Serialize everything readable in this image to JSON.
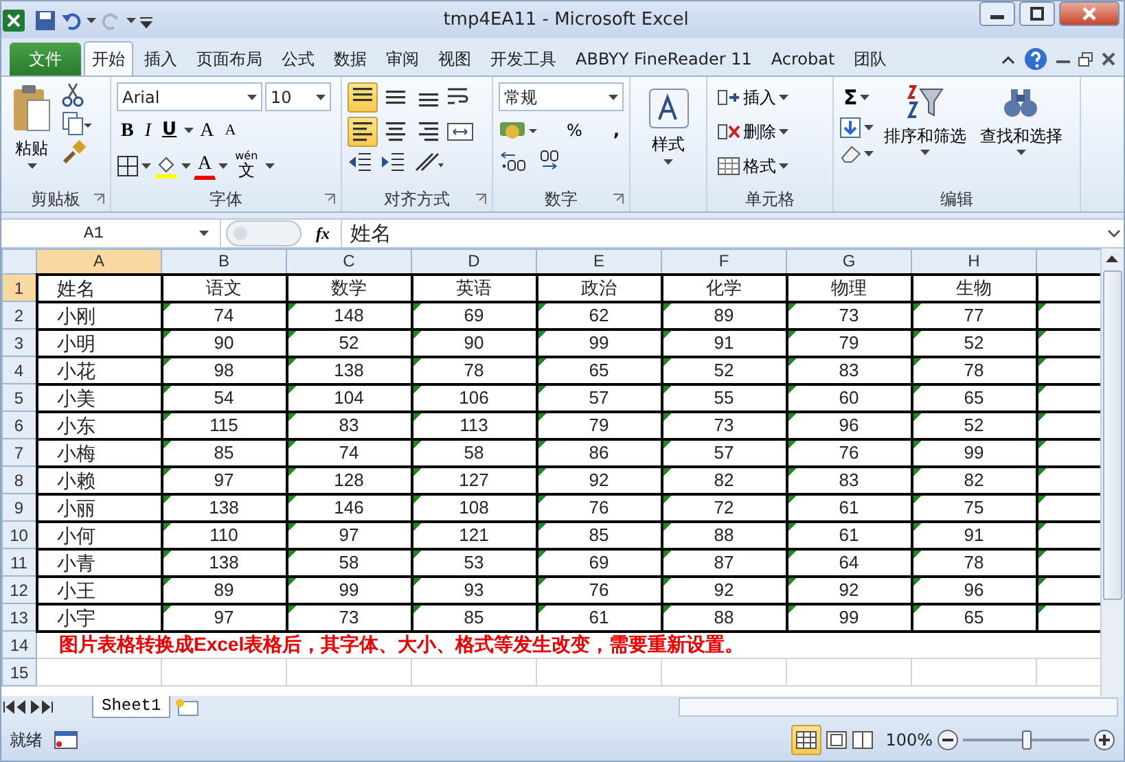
{
  "window": {
    "title": "tmp4EA11  -  Microsoft Excel"
  },
  "ribbon_tabs": [
    {
      "label": "文件",
      "kind": "file"
    },
    {
      "label": "开始",
      "kind": "tab",
      "selected": true
    },
    {
      "label": "插入",
      "kind": "tab",
      "selected": false
    },
    {
      "label": "页面布局",
      "kind": "tab",
      "selected": false
    },
    {
      "label": "公式",
      "kind": "tab",
      "selected": false
    },
    {
      "label": "数据",
      "kind": "tab",
      "selected": false
    },
    {
      "label": "审阅",
      "kind": "tab",
      "selected": false
    },
    {
      "label": "视图",
      "kind": "tab",
      "selected": false
    },
    {
      "label": "开发工具",
      "kind": "tab",
      "selected": false
    },
    {
      "label": "ABBYY FineReader 11",
      "kind": "tab",
      "selected": false
    },
    {
      "label": "Acrobat",
      "kind": "tab",
      "selected": false
    },
    {
      "label": "团队",
      "kind": "tab",
      "selected": false
    }
  ],
  "ribbon": {
    "clipboard": {
      "label": "剪贴板",
      "paste": "粘贴"
    },
    "font": {
      "label": "字体",
      "font_name": "Arial",
      "font_size": "10",
      "bold": "B",
      "italic": "I",
      "underline": "U",
      "grow": "A",
      "shrink": "A",
      "color_letter": "A",
      "phonetic": "文",
      "phonetic_top": "wén"
    },
    "alignment": {
      "label": "对齐方式",
      "vertical": [
        {
          "selected": true
        },
        {
          "selected": false
        },
        {
          "selected": false
        }
      ],
      "horizontal": [
        {
          "selected": true
        },
        {
          "selected": false
        },
        {
          "selected": false
        }
      ]
    },
    "number": {
      "label": "数字",
      "format": "常规",
      "percent": "%",
      "comma": ","
    },
    "styles": {
      "label": "样式"
    },
    "cells": {
      "label": "单元格",
      "items": [
        "插入",
        "删除",
        "格式"
      ]
    },
    "editing": {
      "label": "编辑",
      "sum": "Σ",
      "items": [
        "排序和筛选",
        "查找和选择"
      ]
    }
  },
  "formula_bar": {
    "name_box": "A1",
    "fx": "fx",
    "content": "姓名"
  },
  "columns": [
    {
      "label": "A",
      "selected": true
    },
    {
      "label": "B",
      "selected": false
    },
    {
      "label": "C",
      "selected": false
    },
    {
      "label": "D",
      "selected": false
    },
    {
      "label": "E",
      "selected": false
    },
    {
      "label": "F",
      "selected": false
    },
    {
      "label": "G",
      "selected": false
    },
    {
      "label": "H",
      "selected": false
    }
  ],
  "rows": [
    [
      "姓名",
      "语文",
      "数学",
      "英语",
      "政治",
      "化学",
      "物理",
      "生物"
    ],
    [
      "小刚",
      "74",
      "148",
      "69",
      "62",
      "89",
      "73",
      "77"
    ],
    [
      "小明",
      "90",
      "52",
      "90",
      "99",
      "91",
      "79",
      "52"
    ],
    [
      "小花",
      "98",
      "138",
      "78",
      "65",
      "52",
      "83",
      "78"
    ],
    [
      "小美",
      "54",
      "104",
      "106",
      "57",
      "55",
      "60",
      "65"
    ],
    [
      "小东",
      "115",
      "83",
      "113",
      "79",
      "73",
      "96",
      "52"
    ],
    [
      "小梅",
      "85",
      "74",
      "58",
      "86",
      "57",
      "76",
      "99"
    ],
    [
      "小赖",
      "97",
      "128",
      "127",
      "92",
      "82",
      "83",
      "82"
    ],
    [
      "小丽",
      "138",
      "146",
      "108",
      "76",
      "72",
      "61",
      "75"
    ],
    [
      "小何",
      "110",
      "97",
      "121",
      "85",
      "88",
      "61",
      "91"
    ],
    [
      "小青",
      "138",
      "58",
      "53",
      "69",
      "87",
      "64",
      "78"
    ],
    [
      "小王",
      "89",
      "99",
      "93",
      "76",
      "92",
      "92",
      "96"
    ],
    [
      "小宇",
      "97",
      "73",
      "85",
      "61",
      "88",
      "99",
      "65"
    ]
  ],
  "row_numbers": [
    "1",
    "2",
    "3",
    "4",
    "5",
    "6",
    "7",
    "8",
    "9",
    "10",
    "11",
    "12",
    "13",
    "14",
    "15"
  ],
  "note": "图片表格转换成Excel表格后，其字体、大小、格式等发生改变，需要重新设置。",
  "sheet_tabs": [
    {
      "label": "Sheet1",
      "selected": true
    }
  ],
  "status_bar": {
    "ready": "就绪",
    "zoom": "100%",
    "zoom_slider": {
      "level": 0.5
    }
  }
}
